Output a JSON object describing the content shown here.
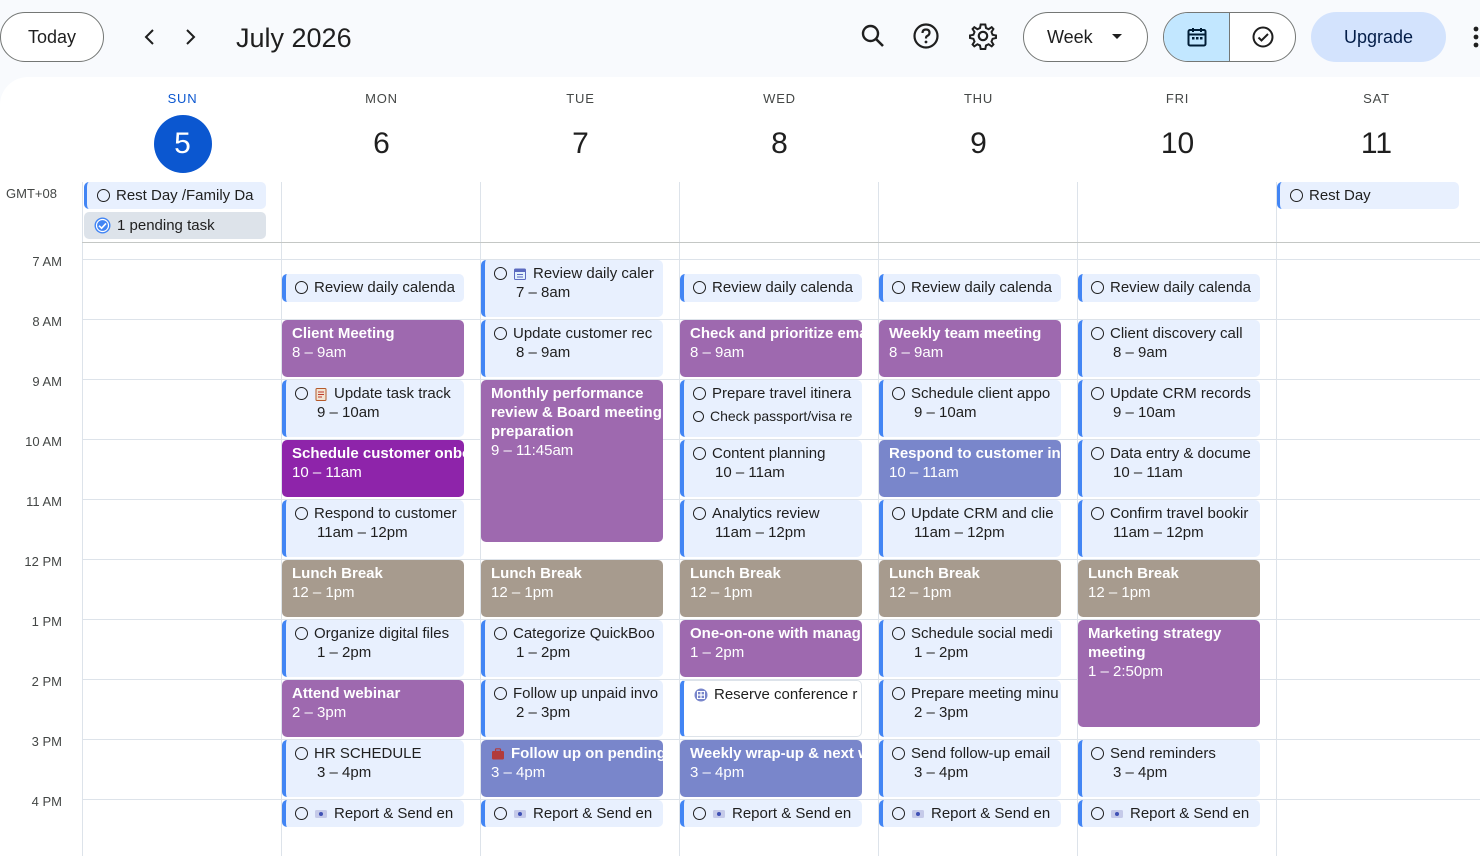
{
  "header": {
    "today_label": "Today",
    "month_title": "July 2026",
    "view_label": "Week",
    "upgrade_label": "Upgrade",
    "icons": [
      "chevron-left-icon",
      "chevron-right-icon",
      "search-icon",
      "help-icon",
      "gear-icon",
      "calendar-icon",
      "task-check-icon",
      "more-vert-icon"
    ]
  },
  "timezone": "GMT+08",
  "days": [
    {
      "name": "SUN",
      "num": "5",
      "today": true
    },
    {
      "name": "MON",
      "num": "6"
    },
    {
      "name": "TUE",
      "num": "7"
    },
    {
      "name": "WED",
      "num": "8"
    },
    {
      "name": "THU",
      "num": "9"
    },
    {
      "name": "FRI",
      "num": "10"
    },
    {
      "name": "SAT",
      "num": "11"
    }
  ],
  "hours": [
    "7 AM",
    "8 AM",
    "9 AM",
    "10 AM",
    "11 AM",
    "12 PM",
    "1 PM",
    "2 PM",
    "3 PM",
    "4 PM"
  ],
  "all_day": {
    "sun_rest": "Rest Day /Family Da",
    "sun_pending": "1 pending task",
    "sat_rest": "Rest Day"
  },
  "events": {
    "mon": [
      {
        "title": "Review daily calenda",
        "time": ""
      },
      {
        "title": "Client Meeting",
        "time": "8 – 9am"
      },
      {
        "title": "Update task track",
        "time": "9 – 10am"
      },
      {
        "title": "Schedule customer onbo",
        "time": "10 – 11am"
      },
      {
        "title": "Respond to customer",
        "time": "11am – 12pm"
      },
      {
        "title": "Lunch Break",
        "time": "12 – 1pm"
      },
      {
        "title": "Organize digital files",
        "time": "1 – 2pm"
      },
      {
        "title": "Attend webinar",
        "time": "2 – 3pm"
      },
      {
        "title": "HR SCHEDULE",
        "time": "3 – 4pm"
      },
      {
        "title": "Report & Send en",
        "time": ""
      }
    ],
    "tue": [
      {
        "title": "Review daily caler",
        "time": "7 – 8am"
      },
      {
        "title": "Update customer rec",
        "time": "8 – 9am"
      },
      {
        "title": "Monthly performance review & Board meeting preparation",
        "time": "9 – 11:45am"
      },
      {
        "title": "Lunch Break",
        "time": "12 – 1pm"
      },
      {
        "title": "Categorize QuickBoo",
        "time": "1 – 2pm"
      },
      {
        "title": "Follow up unpaid invo",
        "time": "2 – 3pm"
      },
      {
        "title": "Follow up on pending",
        "time": "3 – 4pm"
      },
      {
        "title": "Report & Send en",
        "time": ""
      }
    ],
    "wed": [
      {
        "title": "Review daily calenda",
        "time": ""
      },
      {
        "title": "Check and prioritize ema",
        "time": "8 – 9am"
      },
      {
        "title": "Prepare travel itinera",
        "time": ""
      },
      {
        "title": "Check passport/visa re",
        "time": ""
      },
      {
        "title": "Content planning",
        "time": "10 – 11am"
      },
      {
        "title": "Analytics review",
        "time": "11am – 12pm"
      },
      {
        "title": "Lunch Break",
        "time": "12 – 1pm"
      },
      {
        "title": "One-on-one with manag",
        "time": "1 – 2pm"
      },
      {
        "title": "Reserve conference r",
        "time": ""
      },
      {
        "title": "Weekly wrap-up & next w",
        "time": "3 – 4pm"
      },
      {
        "title": "Report & Send en",
        "time": ""
      }
    ],
    "thu": [
      {
        "title": "Review daily calenda",
        "time": ""
      },
      {
        "title": "Weekly team meeting",
        "time": "8 – 9am"
      },
      {
        "title": "Schedule client appo",
        "time": "9 – 10am"
      },
      {
        "title": "Respond to customer inq",
        "time": "10 – 11am"
      },
      {
        "title": "Update CRM and clie",
        "time": "11am – 12pm"
      },
      {
        "title": "Lunch Break",
        "time": "12 – 1pm"
      },
      {
        "title": "Schedule social medi",
        "time": "1 – 2pm"
      },
      {
        "title": "Prepare meeting minu",
        "time": "2 – 3pm"
      },
      {
        "title": "Send follow-up email",
        "time": "3 – 4pm"
      },
      {
        "title": "Report & Send en",
        "time": ""
      }
    ],
    "fri": [
      {
        "title": "Review daily calenda",
        "time": ""
      },
      {
        "title": "Client discovery call",
        "time": "8 – 9am"
      },
      {
        "title": "Update CRM records",
        "time": "9 – 10am"
      },
      {
        "title": "Data entry & docume",
        "time": "10 – 11am"
      },
      {
        "title": "Confirm travel bookir",
        "time": "11am – 12pm"
      },
      {
        "title": "Lunch Break",
        "time": "12 – 1pm"
      },
      {
        "title": "Marketing strategy meeting",
        "time": "1 – 2:50pm"
      },
      {
        "title": "Send reminders",
        "time": "3 – 4pm"
      },
      {
        "title": "Report & Send en",
        "time": ""
      }
    ]
  }
}
